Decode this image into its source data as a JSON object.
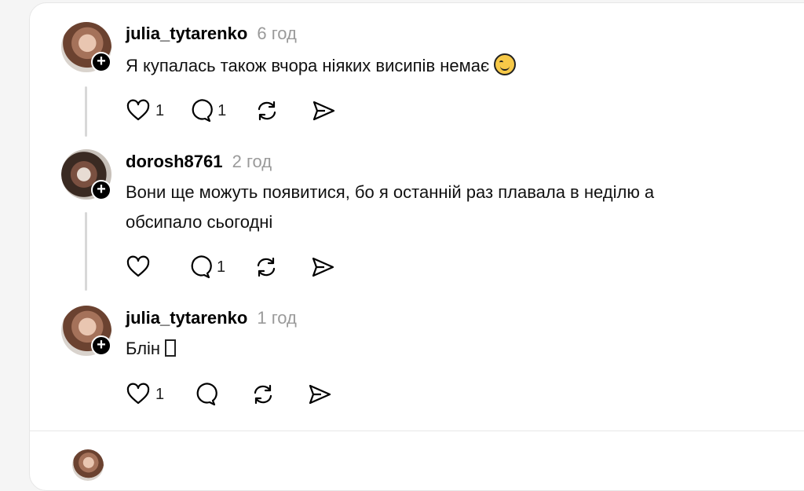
{
  "comments": [
    {
      "username": "julia_tytarenko",
      "time": "6 год",
      "text": "Я купалась також вчора ніяких висипів немає",
      "likes": "1",
      "replies": "1"
    },
    {
      "username": "dorosh8761",
      "time": "2 год",
      "text_line1": "Вони ще можуть появитися, бо я останній раз плавала в неділю а",
      "text_line2": "обсипало сьогодні",
      "likes": "",
      "replies": "1"
    },
    {
      "username": "julia_tytarenko",
      "time": "1 год",
      "text": "Блін",
      "likes": "1",
      "replies": ""
    }
  ],
  "icons": {
    "like": "heart-icon",
    "reply": "comment-icon",
    "repost": "repost-icon",
    "share": "share-icon",
    "follow": "plus-icon",
    "emoji": "smiling-face-emoji"
  }
}
